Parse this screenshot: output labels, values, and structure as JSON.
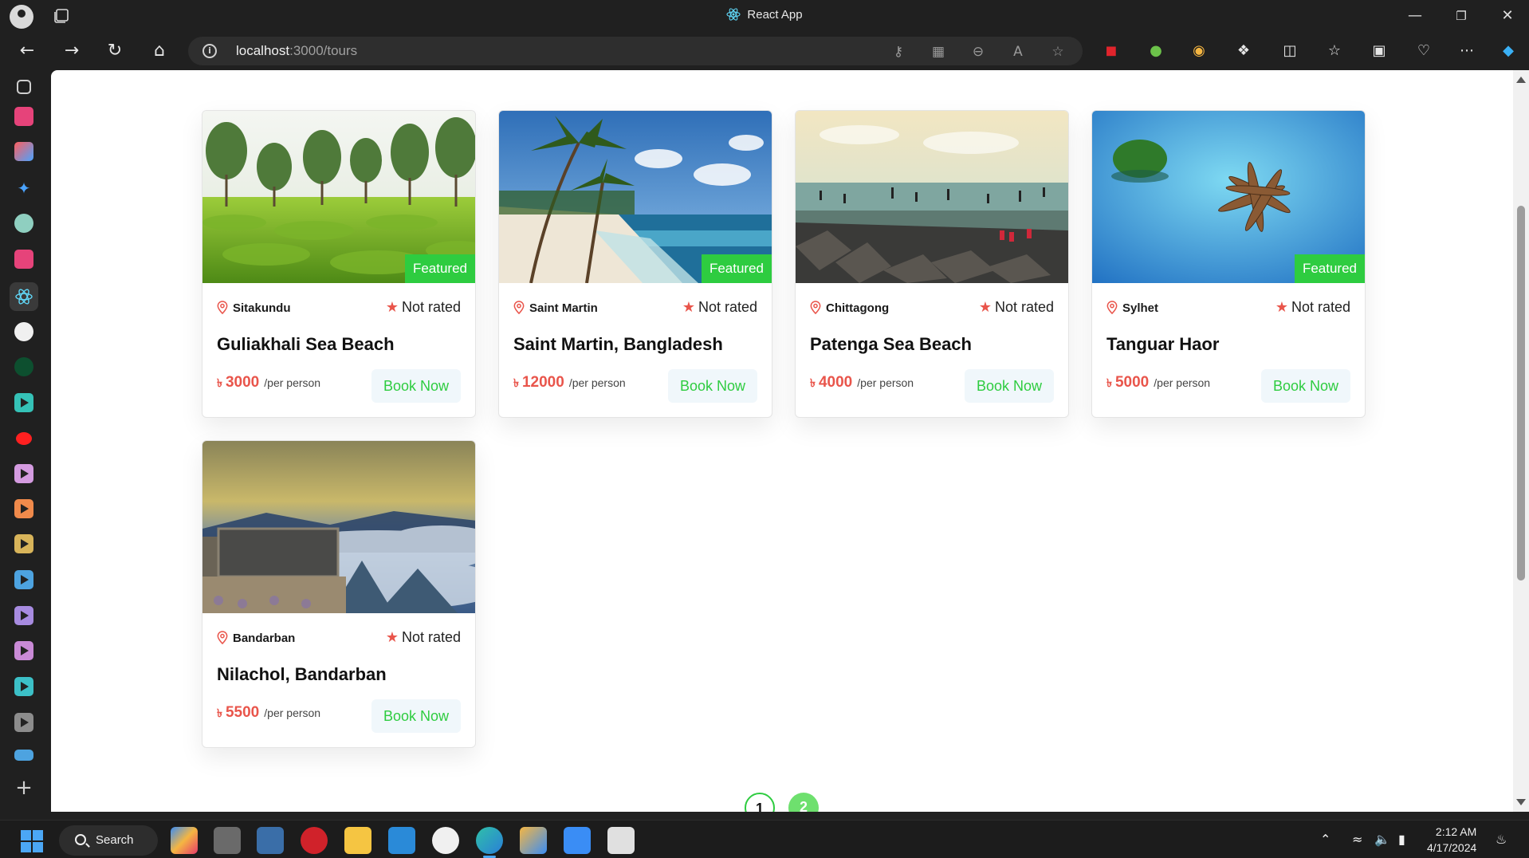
{
  "window": {
    "title": "React App"
  },
  "browser": {
    "url_host": "localhost",
    "url_path": ":3000/tours"
  },
  "tours": [
    {
      "location": "Sitakundu",
      "rating": "Not rated",
      "name": "Guliakhali Sea Beach",
      "currency": "৳",
      "price": "3000",
      "per": "/per person",
      "book": "Book Now",
      "featured": "Featured",
      "is_featured": true
    },
    {
      "location": "Saint Martin",
      "rating": "Not rated",
      "name": "Saint Martin, Bangladesh",
      "currency": "৳",
      "price": "12000",
      "per": "/per person",
      "book": "Book Now",
      "featured": "Featured",
      "is_featured": true
    },
    {
      "location": "Chittagong",
      "rating": "Not rated",
      "name": "Patenga Sea Beach",
      "currency": "৳",
      "price": "4000",
      "per": "/per person",
      "book": "Book Now",
      "featured": "",
      "is_featured": false
    },
    {
      "location": "Sylhet",
      "rating": "Not rated",
      "name": "Tanguar Haor",
      "currency": "৳",
      "price": "5000",
      "per": "/per person",
      "book": "Book Now",
      "featured": "Featured",
      "is_featured": true
    },
    {
      "location": "Bandarban",
      "rating": "Not rated",
      "name": "Nilachol, Bandarban",
      "currency": "৳",
      "price": "5500",
      "per": "/per person",
      "book": "Book Now",
      "featured": "",
      "is_featured": false
    }
  ],
  "pagination": {
    "pages": [
      "1",
      "2"
    ],
    "current": "2"
  },
  "taskbar": {
    "search_label": "Search",
    "time": "2:12 AM",
    "date": "4/17/2024"
  },
  "colors": {
    "accent_green": "#2ecc40",
    "price_red": "#e9554b"
  }
}
